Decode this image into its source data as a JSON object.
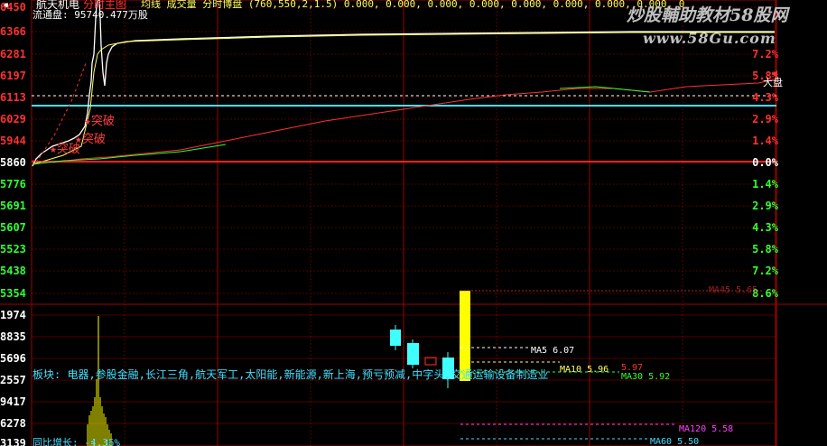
{
  "header": {
    "stock_name": "航天机电",
    "realtime_tag": "分时主图",
    "indicator_line": "均线 成交量 分时博盘 (760,550,2,1.5) 0.000, 0.000, 0.000, 0.000, 0.000, 0.000, 0.000, 0.000, 0"
  },
  "float_info": "流通盘: 95740.477万股",
  "watermark": {
    "title": "炒股輔助教材58股网",
    "url": "www.58Gu.com"
  },
  "price_axis": [
    "6450",
    "6366",
    "6281",
    "6197",
    "6113",
    "6029",
    "5944",
    "5860",
    "5776",
    "5691",
    "5607",
    "5523",
    "5438",
    "5354"
  ],
  "pct_axis": [
    "7.2%",
    "5.8%",
    "4.3%",
    "2.9%",
    "1.4%",
    "0.0%",
    "1.4%",
    "2.9%",
    "4.3%",
    "5.8%",
    "7.2%",
    "8.6%"
  ],
  "dapan_label": "大盘",
  "vol_axis": [
    "1974",
    "8835",
    "5696",
    "2557",
    "9417",
    "6278",
    "3139"
  ],
  "signals": [
    "突破",
    "突破",
    "突破"
  ],
  "sector_text": "板块: 电器,参股金融,长江三角,航天军工,太阳能,新能源,新上海,预亏预减,中字头,交通运输设备制造业",
  "bottom_text": "同比增长: -4.36%",
  "ma_labels": {
    "ma5": "MA5  6.07",
    "ma10": "MA10  5.96",
    "ma10b": "5.97",
    "ma20": "MA20  5.97",
    "ma30": "MA30  5.92",
    "ma120": "MA120  5.58",
    "ma60": "MA60  5.50",
    "top_dashed": "MA45 5.65"
  },
  "colors": {
    "price_up": "#ff3030",
    "price_down": "#30ff30",
    "price_base": "#ffffff",
    "grid": "#a00000",
    "avg_line": "#ffff60",
    "cyan": "#40e0ff",
    "yellow_bar": "#ffff00",
    "candle_cyan": "#40ffff"
  }
}
